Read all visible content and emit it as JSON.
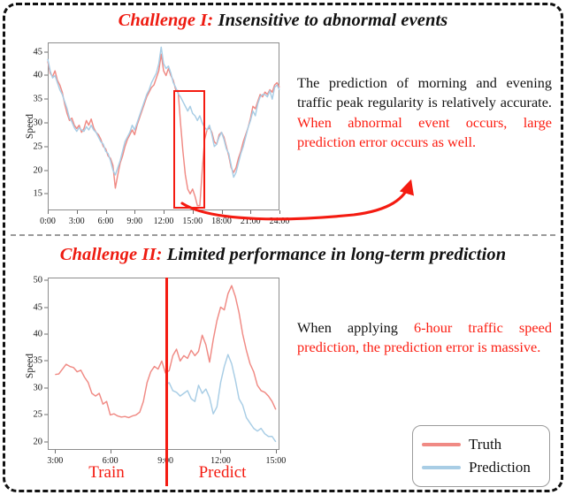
{
  "figure": {
    "accent_red": "#f41b11",
    "truth_color": "#f08a84",
    "prediction_color": "#a8cde5",
    "frame_color": "#8d8d8d"
  },
  "panels": [
    {
      "id": "challenge-1",
      "title_prefix": "Challenge I:",
      "title_text": " Insensitive to abnormal events",
      "annotation": {
        "black_part": "The prediction of morning and evening traffic peak regularity is relatively accurate. ",
        "red_part": "When abnormal event occurs, large prediction error occurs as well."
      },
      "highlight_note": "abnormal-event-highlight-box"
    },
    {
      "id": "challenge-2",
      "title_prefix": "Challenge II:",
      "title_text": " Limited performance in long-term prediction",
      "annotation": {
        "black_part": "When applying ",
        "red_part": "6-hour traffic speed prediction, the prediction error is massive."
      },
      "split_labels": {
        "left": "Train",
        "right": "Predict"
      }
    }
  ],
  "legend": {
    "items": [
      {
        "label": "Truth",
        "color": "#f08a84"
      },
      {
        "label": "Prediction",
        "color": "#a8cde5"
      }
    ]
  },
  "chart_data": [
    {
      "type": "line",
      "id": "chart-1-daily-speed",
      "title": "Insensitive to abnormal events",
      "xlabel": "",
      "ylabel": "Speed",
      "xticks": [
        "0:00",
        "3:00",
        "6:00",
        "9:00",
        "12:00",
        "15:00",
        "18:00",
        "21:00",
        "24:00"
      ],
      "xtick_values": [
        0,
        3,
        6,
        9,
        12,
        15,
        18,
        21,
        24
      ],
      "yticks": [
        15,
        20,
        25,
        30,
        35,
        40,
        45
      ],
      "xlim": [
        0,
        24
      ],
      "ylim": [
        11.5,
        47
      ],
      "grid": false,
      "legend_position": "external-bottom-right",
      "annotation_box": {
        "x_range": [
          13.0,
          16.3
        ],
        "y_range": [
          11.8,
          36.9
        ],
        "color": "#f41b11"
      },
      "series": [
        {
          "name": "Truth",
          "color": "#f08a84",
          "x": [
            0,
            0.25,
            0.5,
            0.75,
            1,
            1.25,
            1.5,
            1.75,
            2,
            2.25,
            2.5,
            2.75,
            3,
            3.25,
            3.5,
            3.75,
            4,
            4.25,
            4.5,
            4.75,
            5,
            5.25,
            5.5,
            5.75,
            6,
            6.25,
            6.5,
            6.75,
            7,
            7.25,
            7.5,
            7.75,
            8,
            8.25,
            8.5,
            8.75,
            9,
            9.25,
            9.5,
            9.75,
            10,
            10.25,
            10.5,
            10.75,
            11,
            11.25,
            11.5,
            11.75,
            12,
            12.25,
            12.5,
            12.75,
            13,
            13.25,
            13.5,
            13.75,
            14,
            14.25,
            14.5,
            14.75,
            15,
            15.25,
            15.5,
            15.75,
            16,
            16.25,
            16.5,
            16.75,
            17,
            17.25,
            17.5,
            17.75,
            18,
            18.25,
            18.5,
            18.75,
            19,
            19.25,
            19.5,
            19.75,
            20,
            20.25,
            20.5,
            20.75,
            21,
            21.25,
            21.5,
            21.75,
            22,
            22.25,
            22.5,
            22.75,
            23,
            23.25,
            23.5,
            23.75,
            24
          ],
          "y": [
            43.0,
            40.5,
            39.8,
            41.0,
            39.0,
            38.0,
            36.5,
            34.0,
            32.0,
            30.5,
            31.0,
            29.5,
            28.8,
            29.5,
            28.0,
            28.8,
            30.5,
            29.5,
            30.8,
            29.0,
            28.0,
            27.5,
            26.5,
            25.0,
            24.5,
            23.0,
            22.5,
            21.0,
            16.2,
            19.0,
            21.5,
            23.0,
            25.0,
            26.5,
            27.5,
            28.5,
            27.5,
            29.5,
            31.0,
            32.5,
            34.0,
            35.5,
            36.5,
            37.5,
            38.0,
            39.5,
            41.0,
            44.5,
            41.0,
            40.0,
            41.5,
            40.0,
            39.0,
            37.0,
            36.8,
            30.0,
            24.0,
            19.0,
            16.0,
            15.0,
            16.0,
            14.5,
            12.5,
            12.5,
            20.0,
            26.5,
            28.5,
            29.0,
            28.0,
            26.0,
            25.5,
            27.5,
            28.0,
            27.0,
            25.0,
            23.0,
            20.5,
            19.5,
            20.5,
            22.5,
            24.0,
            26.0,
            27.5,
            29.0,
            31.0,
            33.5,
            33.0,
            34.5,
            36.0,
            35.5,
            36.5,
            36.0,
            37.0,
            36.5,
            38.0,
            38.5,
            37.5,
            39.0,
            40.2
          ]
        },
        {
          "name": "Prediction",
          "color": "#a8cde5",
          "x": [
            0,
            0.25,
            0.5,
            0.75,
            1,
            1.25,
            1.5,
            1.75,
            2,
            2.25,
            2.5,
            2.75,
            3,
            3.25,
            3.5,
            3.75,
            4,
            4.25,
            4.5,
            4.75,
            5,
            5.25,
            5.5,
            5.75,
            6,
            6.25,
            6.5,
            6.75,
            7,
            7.25,
            7.5,
            7.75,
            8,
            8.25,
            8.5,
            8.75,
            9,
            9.25,
            9.5,
            9.75,
            10,
            10.25,
            10.5,
            10.75,
            11,
            11.25,
            11.5,
            11.75,
            12,
            12.25,
            12.5,
            12.75,
            13,
            13.25,
            13.5,
            13.75,
            14,
            14.25,
            14.5,
            14.75,
            15,
            15.25,
            15.5,
            15.75,
            16,
            16.25,
            16.5,
            16.75,
            17,
            17.25,
            17.5,
            17.75,
            18,
            18.25,
            18.5,
            18.75,
            19,
            19.25,
            19.5,
            19.75,
            20,
            20.25,
            20.5,
            20.75,
            21,
            21.25,
            21.5,
            21.75,
            22,
            22.25,
            22.5,
            22.75,
            23,
            23.25,
            23.5,
            23.75,
            24
          ],
          "y": [
            43.5,
            41.0,
            39.5,
            40.0,
            38.5,
            37.0,
            36.0,
            34.5,
            33.0,
            31.0,
            30.2,
            29.0,
            28.2,
            29.0,
            28.5,
            28.2,
            29.2,
            28.5,
            29.5,
            28.5,
            28.0,
            27.0,
            26.0,
            25.5,
            24.0,
            23.5,
            22.0,
            20.0,
            19.0,
            20.5,
            22.0,
            24.0,
            26.0,
            27.0,
            28.0,
            29.5,
            28.5,
            30.0,
            31.5,
            33.0,
            34.5,
            36.0,
            37.0,
            38.5,
            39.5,
            40.5,
            42.5,
            46.0,
            42.5,
            41.5,
            42.0,
            40.5,
            38.5,
            37.5,
            36.2,
            35.5,
            34.5,
            33.5,
            32.5,
            33.5,
            32.0,
            31.5,
            30.5,
            31.5,
            30.0,
            29.0,
            28.5,
            29.5,
            27.5,
            25.0,
            25.5,
            27.0,
            28.0,
            26.5,
            24.5,
            23.5,
            21.0,
            18.5,
            19.5,
            21.5,
            23.5,
            25.0,
            27.0,
            29.0,
            30.5,
            32.5,
            31.5,
            34.0,
            35.5,
            36.0,
            36.0,
            35.5,
            36.8,
            35.0,
            37.5,
            38.0,
            37.0,
            38.5,
            44.0
          ]
        }
      ]
    },
    {
      "type": "line",
      "id": "chart-2-longterm-speed",
      "title": "Limited performance in long-term prediction",
      "xlabel": "",
      "ylabel": "Speed",
      "xticks": [
        "3:00",
        "6:00",
        "9:00",
        "12:00",
        "15:00"
      ],
      "xtick_values": [
        3,
        6,
        9,
        12,
        15
      ],
      "yticks": [
        20,
        25,
        30,
        35,
        40,
        45,
        50
      ],
      "xlim": [
        2.6,
        15.2
      ],
      "ylim": [
        18.5,
        50.5
      ],
      "grid": false,
      "split_x": 9,
      "split_color": "#f41b11",
      "series": [
        {
          "name": "Truth",
          "color": "#f08a84",
          "x": [
            3,
            3.2,
            3.4,
            3.6,
            3.8,
            4,
            4.2,
            4.4,
            4.6,
            4.8,
            5,
            5.2,
            5.4,
            5.6,
            5.8,
            6,
            6.2,
            6.4,
            6.6,
            6.8,
            7,
            7.2,
            7.4,
            7.6,
            7.8,
            8,
            8.2,
            8.4,
            8.6,
            8.8,
            9,
            9.2,
            9.4,
            9.6,
            9.8,
            10,
            10.2,
            10.4,
            10.6,
            10.8,
            11,
            11.2,
            11.4,
            11.6,
            11.8,
            12,
            12.2,
            12.4,
            12.6,
            12.8,
            13,
            13.2,
            13.4,
            13.6,
            13.8,
            14,
            14.2,
            14.4,
            14.6,
            14.8,
            15
          ],
          "y": [
            32.5,
            32.6,
            33.5,
            34.4,
            34.0,
            33.8,
            33.0,
            33.3,
            32.0,
            31.0,
            29.0,
            28.5,
            29.0,
            27.0,
            27.5,
            25.0,
            25.2,
            24.8,
            24.6,
            24.7,
            24.5,
            24.8,
            25.0,
            25.5,
            27.5,
            31.0,
            33.0,
            34.0,
            33.5,
            35.0,
            32.8,
            33.2,
            36.0,
            37.2,
            35.0,
            36.0,
            35.5,
            37.0,
            36.0,
            36.8,
            39.8,
            38.0,
            34.8,
            39.0,
            42.5,
            45.0,
            44.5,
            47.5,
            49.0,
            47.0,
            44.0,
            40.0,
            37.0,
            34.5,
            33.0,
            30.5,
            29.5,
            29.2,
            28.5,
            27.5,
            26.0
          ]
        },
        {
          "name": "Prediction",
          "color": "#a8cde5",
          "x": [
            9,
            9.2,
            9.4,
            9.6,
            9.8,
            10,
            10.2,
            10.4,
            10.6,
            10.8,
            11,
            11.2,
            11.4,
            11.6,
            11.8,
            12,
            12.2,
            12.4,
            12.6,
            12.8,
            13,
            13.2,
            13.4,
            13.6,
            13.8,
            14,
            14.2,
            14.4,
            14.6,
            14.8,
            15
          ],
          "y": [
            30.5,
            31.0,
            29.5,
            29.2,
            28.5,
            29.0,
            29.5,
            28.0,
            27.5,
            30.5,
            29.0,
            29.8,
            28.2,
            25.2,
            26.5,
            31.0,
            34.0,
            36.2,
            34.5,
            31.5,
            28.0,
            26.8,
            24.5,
            23.5,
            22.5,
            22.0,
            22.5,
            21.5,
            21.0,
            21.0,
            20.0
          ]
        }
      ]
    }
  ]
}
